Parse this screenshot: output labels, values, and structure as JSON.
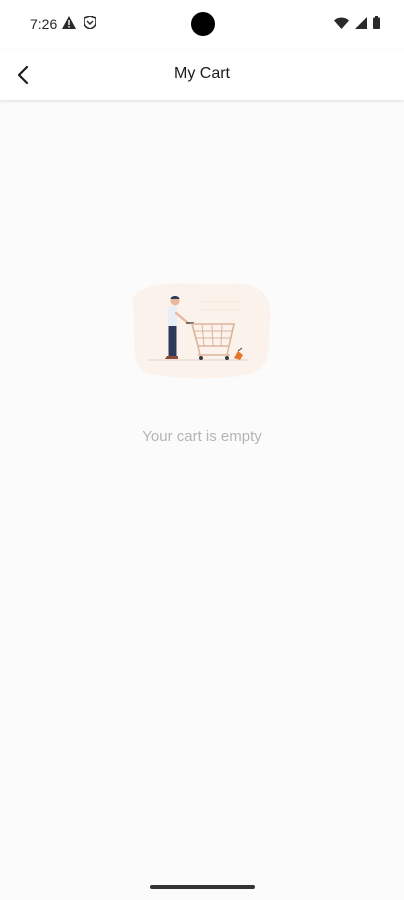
{
  "status": {
    "time": "7:26"
  },
  "header": {
    "title": "My Cart",
    "back_icon": "back-arrow-icon"
  },
  "main": {
    "empty_message": "Your cart is empty",
    "illustration": "empty-cart-illustration"
  },
  "colors": {
    "background": "#fbfbfb",
    "illustration_bg": "#fbf2ec",
    "cart": "#d9b49b",
    "accent": "#e8762e"
  }
}
